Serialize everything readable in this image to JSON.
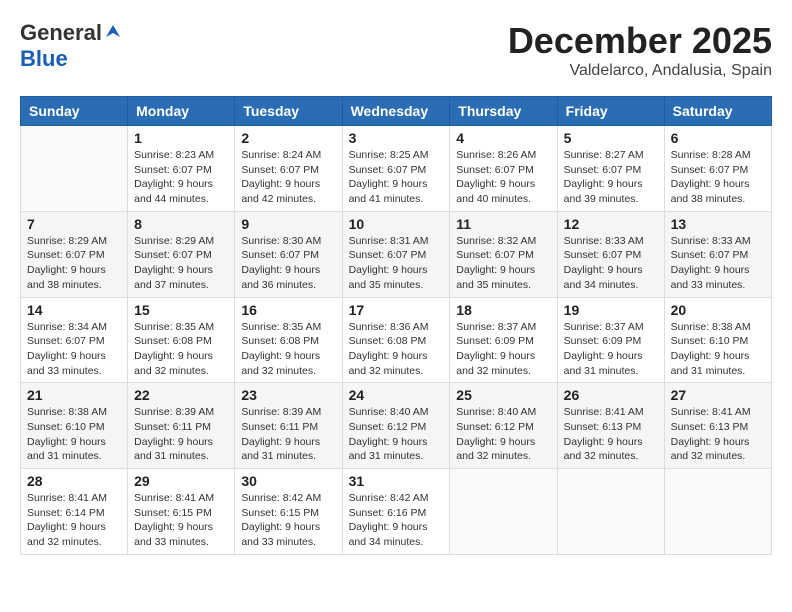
{
  "logo": {
    "general": "General",
    "blue": "Blue"
  },
  "title": "December 2025",
  "location": "Valdelarco, Andalusia, Spain",
  "headers": [
    "Sunday",
    "Monday",
    "Tuesday",
    "Wednesday",
    "Thursday",
    "Friday",
    "Saturday"
  ],
  "weeks": [
    [
      {
        "day": "",
        "info": ""
      },
      {
        "day": "1",
        "info": "Sunrise: 8:23 AM\nSunset: 6:07 PM\nDaylight: 9 hours\nand 44 minutes."
      },
      {
        "day": "2",
        "info": "Sunrise: 8:24 AM\nSunset: 6:07 PM\nDaylight: 9 hours\nand 42 minutes."
      },
      {
        "day": "3",
        "info": "Sunrise: 8:25 AM\nSunset: 6:07 PM\nDaylight: 9 hours\nand 41 minutes."
      },
      {
        "day": "4",
        "info": "Sunrise: 8:26 AM\nSunset: 6:07 PM\nDaylight: 9 hours\nand 40 minutes."
      },
      {
        "day": "5",
        "info": "Sunrise: 8:27 AM\nSunset: 6:07 PM\nDaylight: 9 hours\nand 39 minutes."
      },
      {
        "day": "6",
        "info": "Sunrise: 8:28 AM\nSunset: 6:07 PM\nDaylight: 9 hours\nand 38 minutes."
      }
    ],
    [
      {
        "day": "7",
        "info": "Sunrise: 8:29 AM\nSunset: 6:07 PM\nDaylight: 9 hours\nand 38 minutes."
      },
      {
        "day": "8",
        "info": "Sunrise: 8:29 AM\nSunset: 6:07 PM\nDaylight: 9 hours\nand 37 minutes."
      },
      {
        "day": "9",
        "info": "Sunrise: 8:30 AM\nSunset: 6:07 PM\nDaylight: 9 hours\nand 36 minutes."
      },
      {
        "day": "10",
        "info": "Sunrise: 8:31 AM\nSunset: 6:07 PM\nDaylight: 9 hours\nand 35 minutes."
      },
      {
        "day": "11",
        "info": "Sunrise: 8:32 AM\nSunset: 6:07 PM\nDaylight: 9 hours\nand 35 minutes."
      },
      {
        "day": "12",
        "info": "Sunrise: 8:33 AM\nSunset: 6:07 PM\nDaylight: 9 hours\nand 34 minutes."
      },
      {
        "day": "13",
        "info": "Sunrise: 8:33 AM\nSunset: 6:07 PM\nDaylight: 9 hours\nand 33 minutes."
      }
    ],
    [
      {
        "day": "14",
        "info": "Sunrise: 8:34 AM\nSunset: 6:07 PM\nDaylight: 9 hours\nand 33 minutes."
      },
      {
        "day": "15",
        "info": "Sunrise: 8:35 AM\nSunset: 6:08 PM\nDaylight: 9 hours\nand 32 minutes."
      },
      {
        "day": "16",
        "info": "Sunrise: 8:35 AM\nSunset: 6:08 PM\nDaylight: 9 hours\nand 32 minutes."
      },
      {
        "day": "17",
        "info": "Sunrise: 8:36 AM\nSunset: 6:08 PM\nDaylight: 9 hours\nand 32 minutes."
      },
      {
        "day": "18",
        "info": "Sunrise: 8:37 AM\nSunset: 6:09 PM\nDaylight: 9 hours\nand 32 minutes."
      },
      {
        "day": "19",
        "info": "Sunrise: 8:37 AM\nSunset: 6:09 PM\nDaylight: 9 hours\nand 31 minutes."
      },
      {
        "day": "20",
        "info": "Sunrise: 8:38 AM\nSunset: 6:10 PM\nDaylight: 9 hours\nand 31 minutes."
      }
    ],
    [
      {
        "day": "21",
        "info": "Sunrise: 8:38 AM\nSunset: 6:10 PM\nDaylight: 9 hours\nand 31 minutes."
      },
      {
        "day": "22",
        "info": "Sunrise: 8:39 AM\nSunset: 6:11 PM\nDaylight: 9 hours\nand 31 minutes."
      },
      {
        "day": "23",
        "info": "Sunrise: 8:39 AM\nSunset: 6:11 PM\nDaylight: 9 hours\nand 31 minutes."
      },
      {
        "day": "24",
        "info": "Sunrise: 8:40 AM\nSunset: 6:12 PM\nDaylight: 9 hours\nand 31 minutes."
      },
      {
        "day": "25",
        "info": "Sunrise: 8:40 AM\nSunset: 6:12 PM\nDaylight: 9 hours\nand 32 minutes."
      },
      {
        "day": "26",
        "info": "Sunrise: 8:41 AM\nSunset: 6:13 PM\nDaylight: 9 hours\nand 32 minutes."
      },
      {
        "day": "27",
        "info": "Sunrise: 8:41 AM\nSunset: 6:13 PM\nDaylight: 9 hours\nand 32 minutes."
      }
    ],
    [
      {
        "day": "28",
        "info": "Sunrise: 8:41 AM\nSunset: 6:14 PM\nDaylight: 9 hours\nand 32 minutes."
      },
      {
        "day": "29",
        "info": "Sunrise: 8:41 AM\nSunset: 6:15 PM\nDaylight: 9 hours\nand 33 minutes."
      },
      {
        "day": "30",
        "info": "Sunrise: 8:42 AM\nSunset: 6:15 PM\nDaylight: 9 hours\nand 33 minutes."
      },
      {
        "day": "31",
        "info": "Sunrise: 8:42 AM\nSunset: 6:16 PM\nDaylight: 9 hours\nand 34 minutes."
      },
      {
        "day": "",
        "info": ""
      },
      {
        "day": "",
        "info": ""
      },
      {
        "day": "",
        "info": ""
      }
    ]
  ]
}
